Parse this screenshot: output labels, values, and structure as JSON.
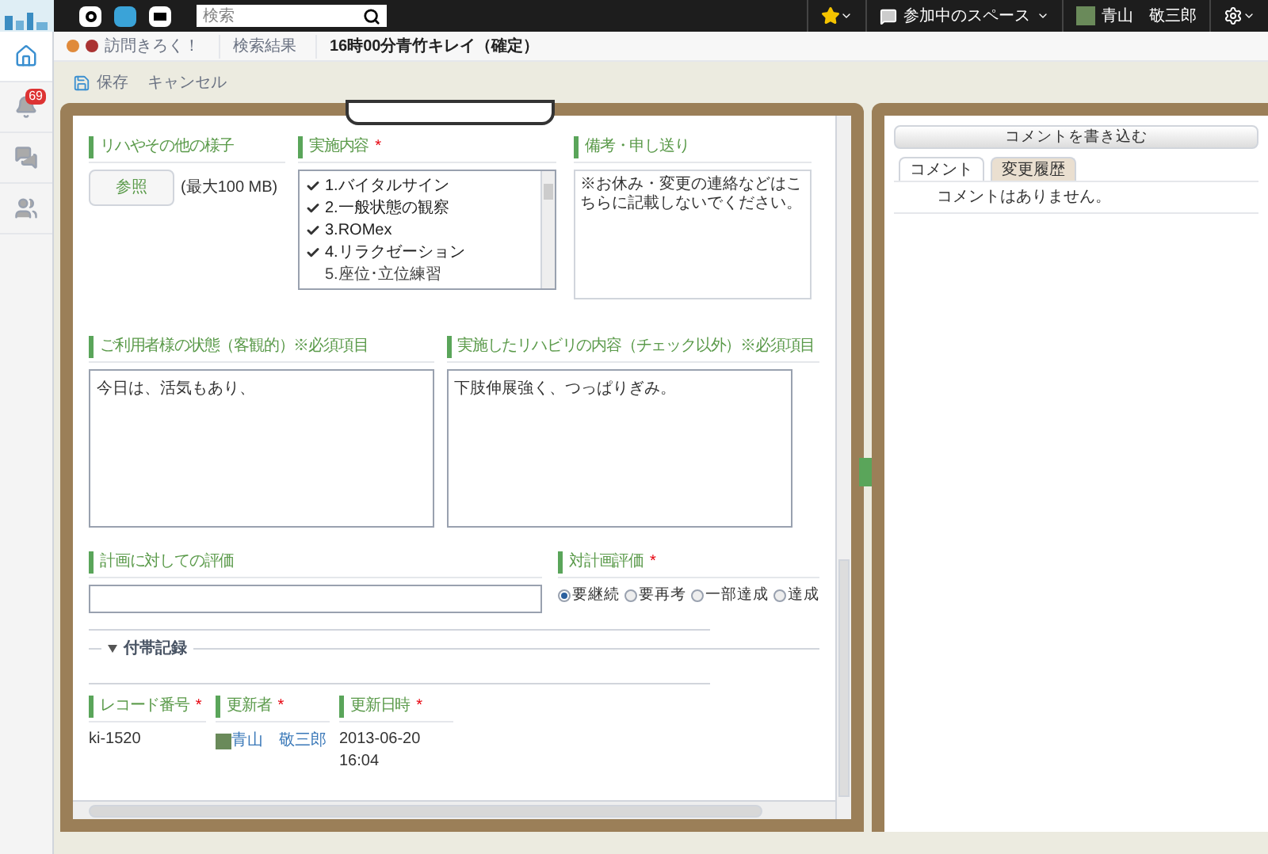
{
  "header": {
    "search": {
      "placeholder": "検索"
    },
    "spaces": "参加中のスペース",
    "user": "青山　敬三郎"
  },
  "sidebar": {
    "items": [
      {
        "kind": "home",
        "selected": true
      },
      {
        "kind": "bell",
        "selected": false,
        "badge": "69"
      },
      {
        "kind": "chat",
        "selected": false
      },
      {
        "kind": "people",
        "selected": false
      }
    ]
  },
  "breadcrumb": [
    "訪問きろく！",
    "検索結果",
    "16時00分青竹キレイ（確定）"
  ],
  "toolbar": {
    "save": "保存",
    "cancel": "キャンセル"
  },
  "form": {
    "attachment": {
      "label": "リハやその他の様子",
      "button": "参照",
      "note": "(最大100 MB)"
    },
    "activities": {
      "label": "実施内容",
      "mark": "*",
      "items": [
        {
          "label": "1.バイタルサイン",
          "checked": true
        },
        {
          "label": "2.一般状態の観察",
          "checked": true
        },
        {
          "label": "3.ROMex",
          "checked": true
        },
        {
          "label": "4.リラクゼーション",
          "checked": true
        },
        {
          "label": "5.座位･立位練習",
          "checked": false
        }
      ]
    },
    "remarks": {
      "label": "備考・申し送り",
      "value": "※お休み・変更の連絡などはこちらに記載しないでください。"
    },
    "condition": {
      "label": "ご利用者様の状態（客観的）※必須項目",
      "value": "今日は、活気もあり、"
    },
    "rehab": {
      "label": "実施したリハビリの内容（チェック以外）※必須項目",
      "value": "下肢伸展強く、つっぱりぎみ。"
    },
    "plan_eval": {
      "label": "計画に対しての評価"
    },
    "plan_rating": {
      "label": "対計画評価",
      "mark": "*",
      "options": [
        {
          "label": "要継続",
          "selected": true
        },
        {
          "label": "要再考",
          "selected": false
        },
        {
          "label": "一部達成",
          "selected": false
        },
        {
          "label": "達成",
          "selected": false
        }
      ]
    },
    "section": "付帯記録",
    "meta": [
      {
        "label": "レコード番号",
        "mark": "*",
        "kind": "text",
        "value": "ki-1520"
      },
      {
        "label": "更新者",
        "mark": "*",
        "kind": "user",
        "value": "青山　敬三郎"
      },
      {
        "label": "更新日時",
        "mark": "*",
        "kind": "datetime",
        "value": "2013-06-20",
        "value2": "16:04"
      }
    ]
  },
  "comments": {
    "write_button": "コメントを書き込む",
    "tabs": [
      {
        "label": "コメント",
        "selected": true
      },
      {
        "label": "変更履歴",
        "selected": false
      }
    ],
    "empty": "コメントはありません。"
  }
}
